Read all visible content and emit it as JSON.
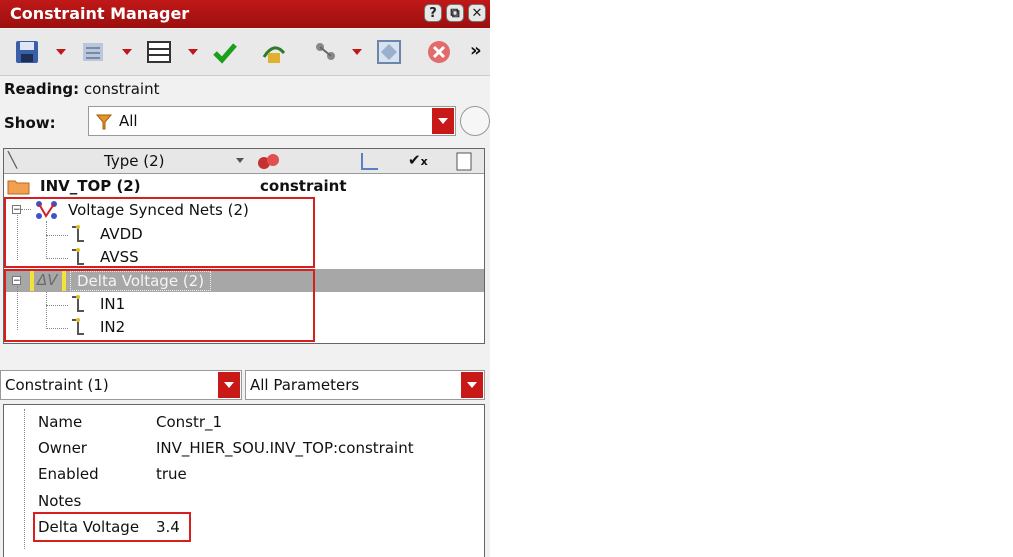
{
  "window": {
    "title": "Constraint Manager",
    "controls": [
      "?",
      "⧉",
      "✕"
    ]
  },
  "toolbar": {
    "overflow": "»"
  },
  "reading": {
    "label": "Reading:",
    "value": "constraint"
  },
  "show": {
    "label": "Show:",
    "value": "All"
  },
  "columns": {
    "type": "Type (2)"
  },
  "tree": {
    "root": {
      "name": "INV_TOP (2)",
      "value": "constraint"
    },
    "groups": [
      {
        "label": "Voltage Synced Nets (2)",
        "children": [
          "AVDD",
          "AVSS"
        ]
      },
      {
        "label": "Delta Voltage (2)",
        "children": [
          "IN1",
          "IN2"
        ],
        "selected": true
      }
    ]
  },
  "filters": {
    "left": "Constraint (1)",
    "right": "All Parameters"
  },
  "properties": [
    {
      "key": "Name",
      "value": "Constr_1"
    },
    {
      "key": "Owner",
      "value": "INV_HIER_SOU.INV_TOP:constraint"
    },
    {
      "key": "Enabled",
      "value": "true"
    },
    {
      "key": "Notes",
      "value": ""
    },
    {
      "key": "Delta Voltage",
      "value": "3.4"
    }
  ],
  "colors": {
    "accent": "#c01818",
    "highlight": "#d62020",
    "selection": "#a7a7a7"
  }
}
